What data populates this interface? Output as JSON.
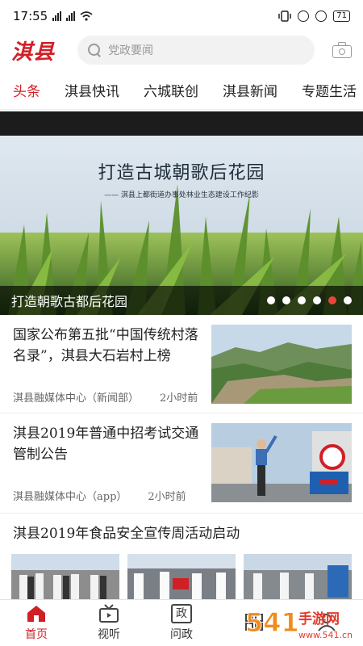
{
  "status": {
    "time": "17:55",
    "battery": "71"
  },
  "header": {
    "logo": "淇县",
    "search_placeholder": "党政要闻"
  },
  "tabs": [
    "头条",
    "淇县快讯",
    "六城联创",
    "淇县新闻",
    "专题生活"
  ],
  "banner": {
    "headline": "打造古城朝歌后花园",
    "subline": "—— 淇县上都街道办事处林业生态建设工作纪影",
    "caption": "打造朝歌古都后花园",
    "slide_count": 6,
    "active_slide": 5
  },
  "news": [
    {
      "title": "国家公布第五批“中国传统村落名录”，淇县大石岩村上榜",
      "source": "淇县融媒体中心（新闻部）",
      "time": "2小时前"
    },
    {
      "title": " 淇县2019年普通中招考试交通管制公告",
      "source": "淇县融媒体中心（app）",
      "time": "2小时前"
    },
    {
      "title": "淇县2019年食品安全宣传周活动启动"
    }
  ],
  "bottom_nav": [
    {
      "label": "首页",
      "icon": "home-icon"
    },
    {
      "label": "视听",
      "icon": "tv-icon"
    },
    {
      "label": "问政",
      "icon": "zheng-icon"
    },
    {
      "label": "",
      "icon": "service-icon"
    },
    {
      "label": "",
      "icon": "profile-icon"
    }
  ],
  "watermark": {
    "brand": "541手游网",
    "url": "www.541.cn"
  },
  "colors": {
    "accent": "#d11f26",
    "dot_active": "#e8453c"
  }
}
